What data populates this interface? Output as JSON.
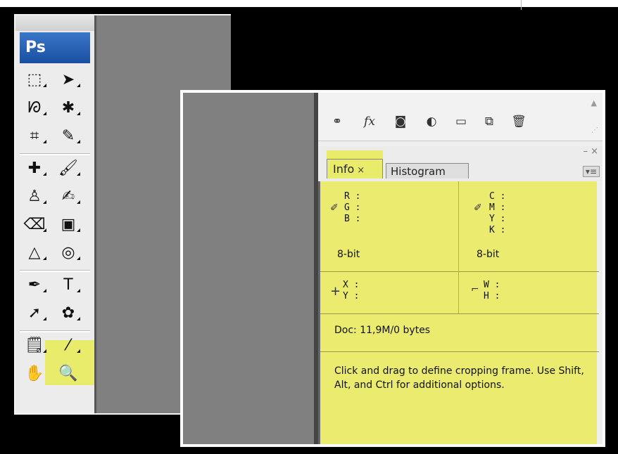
{
  "app": {
    "logo": "Ps"
  },
  "tools": [
    {
      "name": "marquee-tool-icon",
      "glyph": "⬚"
    },
    {
      "name": "move-tool-icon",
      "glyph": "➤"
    },
    {
      "name": "lasso-tool-icon",
      "glyph": "ᘗ"
    },
    {
      "name": "magic-wand-tool-icon",
      "glyph": "✱"
    },
    {
      "name": "crop-tool-icon",
      "glyph": "⌗"
    },
    {
      "name": "slice-tool-icon",
      "glyph": "✎"
    },
    {
      "name": "healing-brush-tool-icon",
      "glyph": "✚"
    },
    {
      "name": "brush-tool-icon",
      "glyph": "🖌"
    },
    {
      "name": "clone-stamp-tool-icon",
      "glyph": "♙"
    },
    {
      "name": "history-brush-tool-icon",
      "glyph": "✍"
    },
    {
      "name": "eraser-tool-icon",
      "glyph": "⌫"
    },
    {
      "name": "gradient-tool-icon",
      "glyph": "▣"
    },
    {
      "name": "blur-tool-icon",
      "glyph": "△"
    },
    {
      "name": "dodge-tool-icon",
      "glyph": "◎"
    },
    {
      "name": "pen-tool-icon",
      "glyph": "✒"
    },
    {
      "name": "type-tool-icon",
      "glyph": "T"
    },
    {
      "name": "path-selection-tool-icon",
      "glyph": "➚"
    },
    {
      "name": "custom-shape-tool-icon",
      "glyph": "✿"
    },
    {
      "name": "notes-tool-icon",
      "glyph": "🗒"
    },
    {
      "name": "eyedropper-tool-icon",
      "glyph": "⁄"
    },
    {
      "name": "hand-tool-icon",
      "glyph": "✋"
    },
    {
      "name": "zoom-tool-icon",
      "glyph": "🔍"
    }
  ],
  "layers_bar": {
    "icons": [
      {
        "name": "link-layers-icon",
        "glyph": "⚭"
      },
      {
        "name": "fx-icon",
        "glyph": "fx"
      },
      {
        "name": "layer-mask-icon",
        "glyph": "◙"
      },
      {
        "name": "adjustment-layer-icon",
        "glyph": "◐"
      },
      {
        "name": "new-group-icon",
        "glyph": "▭"
      },
      {
        "name": "new-layer-icon",
        "glyph": "⧉"
      },
      {
        "name": "trash-icon",
        "glyph": "🗑"
      }
    ]
  },
  "panel": {
    "tabs": [
      {
        "label": "Info",
        "close": "×",
        "active": true
      },
      {
        "label": "Histogram",
        "active": false
      }
    ],
    "window_controls": "– ×",
    "menu_glyph": "▾≡"
  },
  "info": {
    "rgb": {
      "r": "R :",
      "g": "G :",
      "b": "B :",
      "depth": "8-bit"
    },
    "cmyk": {
      "c": "C :",
      "m": "M :",
      "y": "Y :",
      "k": "K :",
      "depth": "8-bit"
    },
    "xy": {
      "x": "X :",
      "y": "Y :"
    },
    "wh": {
      "w": "W :",
      "h": "H :"
    },
    "doc": "Doc: 11,9M/0 bytes",
    "hint": "Click and drag to define cropping frame. Use Shift, Alt, and Ctrl for additional options."
  },
  "colors": {
    "highlight": "#e9eb6a",
    "canvas_gray": "#808080",
    "ps_blue": "#1a4fa0"
  }
}
